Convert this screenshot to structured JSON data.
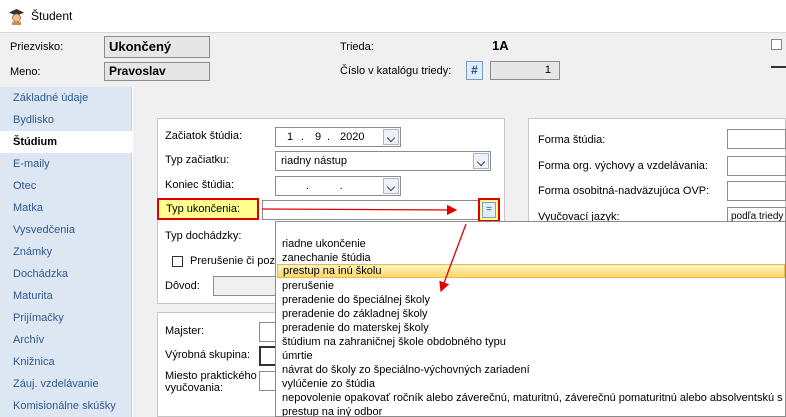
{
  "window": {
    "title": "Študent",
    "icon": "student-graduate-icon"
  },
  "header": {
    "surname_label": "Priezvisko:",
    "surname_value": "Ukončený",
    "name_label": "Meno:",
    "name_value": "Pravoslav",
    "class_label": "Trieda:",
    "class_value": "1A",
    "catalog_label": "Číslo v katalógu triedy:",
    "catalog_button": "#",
    "catalog_value": "1"
  },
  "sidebar": {
    "items": [
      {
        "label": "Základné údaje"
      },
      {
        "label": "Bydlisko"
      },
      {
        "label": "Štúdium"
      },
      {
        "label": "E-maily"
      },
      {
        "label": "Otec"
      },
      {
        "label": "Matka"
      },
      {
        "label": "Vysvedčenia"
      },
      {
        "label": "Známky"
      },
      {
        "label": "Dochádzka"
      },
      {
        "label": "Maturita"
      },
      {
        "label": "Prijímačky"
      },
      {
        "label": "Archív"
      },
      {
        "label": "Knižnica"
      },
      {
        "label": "Záuj. vzdelávanie"
      },
      {
        "label": "Komisionálne skúšky"
      }
    ],
    "active_index": 2
  },
  "study": {
    "start_label": "Začiatok štúdia:",
    "start_day": "1",
    "start_month": "9",
    "start_year": "2020",
    "start_type_label": "Typ začiatku:",
    "start_type_value": "riadny nástup",
    "end_label": "Koniec štúdia:",
    "end_placeholder": ".          .",
    "end_type_label": "Typ ukončenia:",
    "end_type_value": "",
    "eq_button": "=",
    "attendance_label": "Typ dochádzky:",
    "interruption_label": "Prerušenie či poz",
    "reason_label": "Dôvod:"
  },
  "bottom_panel": {
    "master_label": "Majster:",
    "production_group_label": "Výrobná skupina:",
    "practice_place_label_1": "Miesto praktického",
    "practice_place_label_2": "vyučovania:"
  },
  "right_panel": {
    "form_label": "Forma štúdia:",
    "org_form_label": "Forma org. výchovy a vzdelávania:",
    "special_form_label": "Forma osobitná-nadväzujúca OVP:",
    "language_label": "Vyučovací jazyk:",
    "language_value": "podľa triedy"
  },
  "dropdown": {
    "options": [
      "riadne ukončenie",
      "zanechanie štúdia",
      "prestup na inú školu",
      "prerušenie",
      "preradenie do špeciálnej školy",
      "preradenie do základnej školy",
      "preradenie do materskej školy",
      "štúdium na zahraničnej škole obdobného typu",
      "úmrtie",
      "návrat do školy zo špeciálno-výchovných zariadení",
      "vylúčenie zo štúdia",
      "nepovolenie opakovať ročník alebo záverečnú, maturitnú, záverečnú pomaturitnú alebo absolventskú s",
      "prestup na iný odbor"
    ],
    "highlighted_index": 2
  },
  "colors": {
    "highlight_border": "#e00000",
    "highlight_fill": "#fffe8f",
    "nav_bg": "#dde6f3",
    "nav_text": "#2f5a8e"
  }
}
